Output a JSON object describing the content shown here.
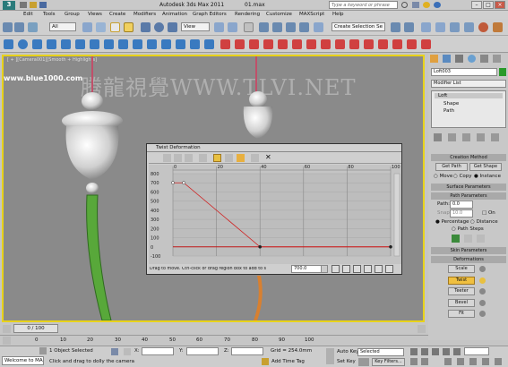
{
  "title": {
    "app": "Autodesk 3ds Max  2011",
    "file": "01.max",
    "search_placeholder": "Type a keyword or phrase"
  },
  "menu": [
    "Edit",
    "Tools",
    "Group",
    "Views",
    "Create",
    "Modifiers",
    "Animation",
    "Graph Editors",
    "Rendering",
    "Customize",
    "MAXScript",
    "Help"
  ],
  "toolbar": {
    "selection_filter": "All",
    "ref_coord": "View",
    "named_selection": "Create Selection Se"
  },
  "viewport": {
    "label": "[ + ][Camera001][Smooth + Highlights]",
    "watermark": "腾龍視覺WWW.TLVI.NET",
    "site": "www.blue1000.com"
  },
  "panel": {
    "object_name": "Loft003",
    "modifier_list": "Modifier List",
    "stack": [
      "Loft",
      "Shape",
      "Path"
    ],
    "creation_method": {
      "title": "Creation Method",
      "get_path": "Get Path",
      "get_shape": "Get Shape",
      "move": "Move",
      "copy": "Copy",
      "instance": "Instance"
    },
    "surface_parameters": "Surface Parameters",
    "path_parameters": {
      "title": "Path Parameters",
      "path_label": "Path:",
      "path_value": "0.0",
      "snap_label": "Snap:",
      "snap_value": "10.0",
      "on_label": "On",
      "percentage": "Percentage",
      "distance": "Distance",
      "path_steps": "Path Steps"
    },
    "skin_parameters": "Skin Parameters",
    "deformations": {
      "title": "Deformations",
      "items": [
        "Scale",
        "Twist",
        "Teeter",
        "Bevel",
        "Fit"
      ],
      "active": "Twist"
    }
  },
  "dialog": {
    "title": "Twist Deformation",
    "ruler_ticks": [
      "0",
      "20",
      "40",
      "60",
      "80",
      "100"
    ],
    "y_ticks": [
      "800",
      "700",
      "600",
      "500",
      "400",
      "300",
      "200",
      "100",
      "0",
      "-100"
    ],
    "status_hint": "Drag to move. Ctrl-click or drag region box to add to s",
    "value_field": "700.0"
  },
  "chart_data": {
    "type": "line",
    "x": [
      0,
      5,
      40,
      100
    ],
    "y": [
      700,
      700,
      0,
      0
    ],
    "xlim": [
      0,
      100
    ],
    "ylim": [
      -100,
      800
    ],
    "colors": {
      "curve": "#d02020",
      "zero_line": "#c01818",
      "point": "#222222"
    }
  },
  "timeline": {
    "frame": "0 / 100",
    "ticks": [
      "0",
      "10",
      "20",
      "30",
      "40",
      "50",
      "60",
      "70",
      "80",
      "90",
      "100"
    ]
  },
  "status": {
    "welcome": "Welcome to MAX:",
    "selected": "1 Object Selected",
    "prompt": "Click and drag to dolly the camera",
    "x_label": "X:",
    "y_label": "Y:",
    "z_label": "Z:",
    "grid": "Grid = 254.0mm",
    "add_time_tag": "Add Time Tag",
    "auto_key": "Auto Key",
    "key_mode": "Selected",
    "set_key": "Set Key",
    "key_filters": "Key Filters..."
  }
}
